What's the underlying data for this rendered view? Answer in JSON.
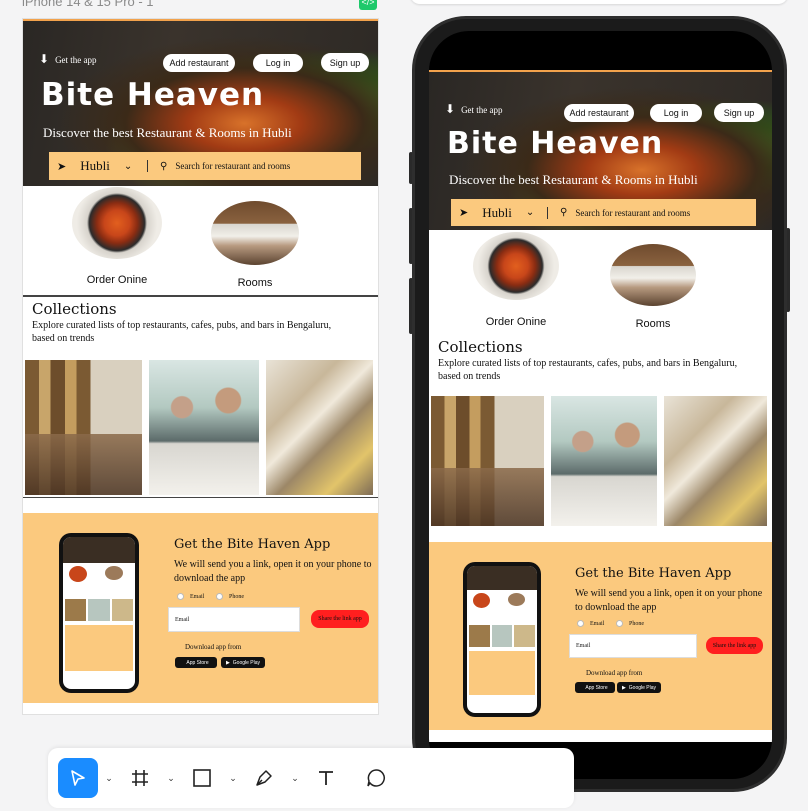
{
  "canvas": {
    "frame_title": "iPhone 14 & 15 Pro - 1",
    "frame_tag_icon": "code-icon"
  },
  "site": {
    "get_app": "Get the app",
    "add_restaurant": "Add restaurant",
    "login": "Log in",
    "signup": "Sign up",
    "brand": "Bite Heaven",
    "tagline": "Discover the best Restaurant & Rooms in Hubli",
    "location": "Hubli",
    "search_placeholder": "Search for restaurant and rooms",
    "categories": [
      {
        "label": "Order Onine",
        "icon": "food-dish-image"
      },
      {
        "label": "Rooms",
        "icon": "hotel-room-image"
      }
    ],
    "collections_title": "Collections",
    "collections_desc": "Explore curated lists of top restaurants, cafes, pubs, and bars in Bengaluru, based on trends",
    "promo_title": "Get the Bite Haven App",
    "promo_text": "We will send you a link, open it on your phone to download the app",
    "radio_email": "Email",
    "radio_phone": "Phone",
    "email_placeholder": "Email",
    "share_button": "Share the link app",
    "download_from": "Download app from",
    "app_store": "App Store",
    "google_play": "Google Play"
  },
  "toolbar": {
    "tools": [
      "move-tool-icon",
      "frame-tool-icon",
      "shape-tool-icon",
      "pen-tool-icon",
      "text-tool-icon",
      "comment-tool-icon"
    ],
    "active_tool": "move-tool-icon",
    "accent": "#1a8cff"
  },
  "colors": {
    "search_bar": "#fbc97e",
    "share_button": "#ff1f1f"
  }
}
